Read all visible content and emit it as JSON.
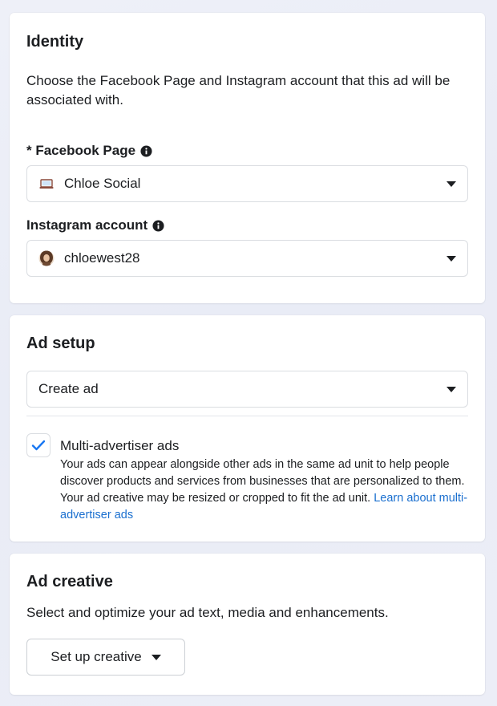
{
  "identity": {
    "title": "Identity",
    "description": "Choose the Facebook Page and Instagram account that this ad will be associated with.",
    "facebook_page": {
      "label": "* Facebook Page",
      "value": "Chloe Social",
      "icon": "laptop-icon"
    },
    "instagram_account": {
      "label": "Instagram account",
      "value": "chloewest28",
      "icon": "avatar"
    }
  },
  "ad_setup": {
    "title": "Ad setup",
    "select_value": "Create ad",
    "multi_advertiser": {
      "checked": true,
      "title": "Multi-advertiser ads",
      "description": "Your ads can appear alongside other ads in the same ad unit to help people discover products and services from businesses that are personalized to them. Your ad creative may be resized or cropped to fit the ad unit.",
      "link_text": "Learn about multi-advertiser ads"
    }
  },
  "ad_creative": {
    "title": "Ad creative",
    "description": "Select and optimize your ad text, media and enhancements.",
    "button_label": "Set up creative"
  },
  "colors": {
    "link": "#1a6fcf",
    "check": "#1877f2",
    "text": "#1c1e21",
    "border": "#dadde1"
  }
}
